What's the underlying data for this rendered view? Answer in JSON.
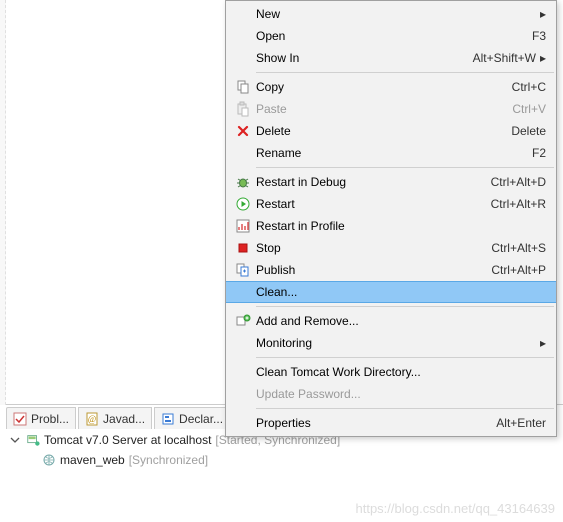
{
  "tabs": [
    {
      "label": "Probl...",
      "icon": "problems"
    },
    {
      "label": "Javad...",
      "icon": "javadoc"
    },
    {
      "label": "Declar...",
      "icon": "declaration"
    }
  ],
  "tree": {
    "server_label": "Tomcat v7.0 Server at localhost",
    "server_status": "  [Started, Synchronized]",
    "module_label": "maven_web",
    "module_status": "  [Synchronized]"
  },
  "watermark": "https://blog.csdn.net/qq_43164639",
  "menu": {
    "new": {
      "label": "New",
      "shortcut": ""
    },
    "open": {
      "label": "Open",
      "shortcut": "F3"
    },
    "show_in": {
      "label": "Show In",
      "shortcut": "Alt+Shift+W"
    },
    "copy": {
      "label": "Copy",
      "shortcut": "Ctrl+C"
    },
    "paste": {
      "label": "Paste",
      "shortcut": "Ctrl+V"
    },
    "delete": {
      "label": "Delete",
      "shortcut": "Delete"
    },
    "rename": {
      "label": "Rename",
      "shortcut": "F2"
    },
    "restart_debug": {
      "label": "Restart in Debug",
      "shortcut": "Ctrl+Alt+D"
    },
    "restart": {
      "label": "Restart",
      "shortcut": "Ctrl+Alt+R"
    },
    "restart_profile": {
      "label": "Restart in Profile",
      "shortcut": ""
    },
    "stop": {
      "label": "Stop",
      "shortcut": "Ctrl+Alt+S"
    },
    "publish": {
      "label": "Publish",
      "shortcut": "Ctrl+Alt+P"
    },
    "clean": {
      "label": "Clean...",
      "shortcut": ""
    },
    "add_remove": {
      "label": "Add and Remove...",
      "shortcut": ""
    },
    "monitoring": {
      "label": "Monitoring",
      "shortcut": ""
    },
    "clean_work": {
      "label": "Clean Tomcat Work Directory...",
      "shortcut": ""
    },
    "update_pw": {
      "label": "Update Password...",
      "shortcut": ""
    },
    "properties": {
      "label": "Properties",
      "shortcut": "Alt+Enter"
    }
  }
}
